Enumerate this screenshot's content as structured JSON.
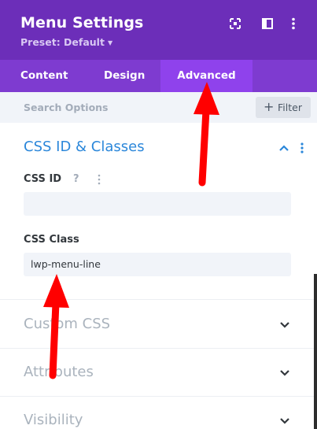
{
  "header": {
    "title": "Menu Settings",
    "preset_label": "Preset: Default",
    "icons": [
      "fullscreen-icon",
      "split-view-icon",
      "more-options-icon"
    ]
  },
  "tabs": [
    {
      "label": "Content",
      "active": false
    },
    {
      "label": "Design",
      "active": false
    },
    {
      "label": "Advanced",
      "active": true
    }
  ],
  "search": {
    "placeholder": "Search Options",
    "filter_label": "Filter"
  },
  "sections": {
    "css_id_classes": {
      "title": "CSS ID & Classes",
      "expanded": true,
      "css_id": {
        "label": "CSS ID",
        "help": "?",
        "value": ""
      },
      "css_class": {
        "label": "CSS Class",
        "value": "lwp-menu-line"
      }
    },
    "custom_css": {
      "title": "Custom CSS",
      "expanded": false
    },
    "attributes": {
      "title": "Attributes",
      "expanded": false
    },
    "visibility": {
      "title": "Visibility",
      "expanded": false
    }
  },
  "colors": {
    "header": "#6c2eb9",
    "tabs": "#7e3bd0",
    "active_tab": "#8f42ec",
    "section_title": "#2b87da",
    "annotation_arrow": "#ff0000"
  }
}
